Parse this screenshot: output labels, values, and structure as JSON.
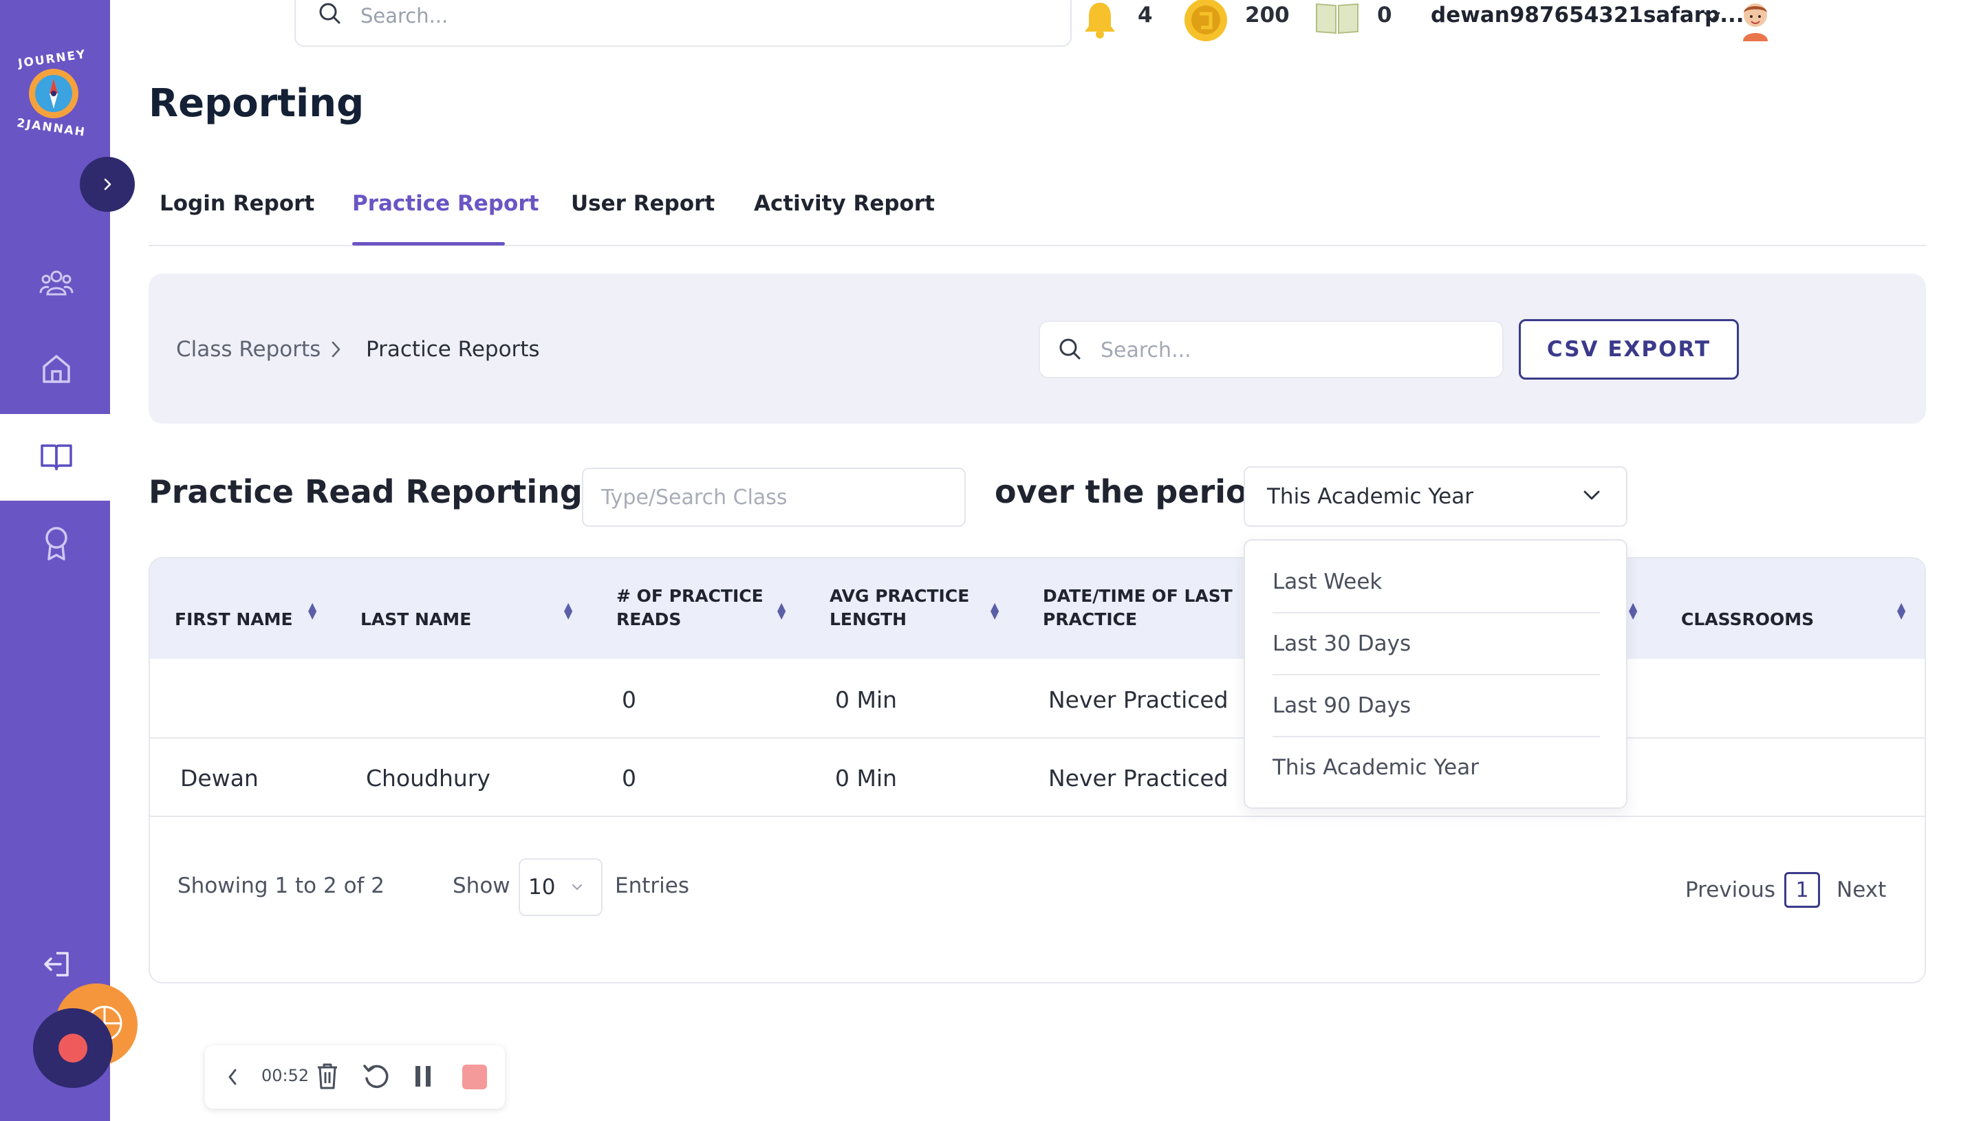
{
  "header": {
    "search_placeholder": "Search...",
    "notifications_count": "4",
    "coins_count": "200",
    "books_count": "0",
    "username": "dewan987654321safarp..."
  },
  "logo": {
    "text_top": "JOURNEY",
    "text_bottom": "2JANNAH"
  },
  "page": {
    "title": "Reporting"
  },
  "tabs": [
    {
      "label": "Login Report"
    },
    {
      "label": "Practice Report",
      "active": true
    },
    {
      "label": "User Report"
    },
    {
      "label": "Activity Report"
    }
  ],
  "breadcrumb": {
    "parent": "Class Reports",
    "current": "Practice Reports"
  },
  "panel": {
    "search_placeholder": "Search...",
    "csv_label": "CSV EXPORT"
  },
  "filters": {
    "label_prefix": "Practice Read Reporting for",
    "class_placeholder": "Type/Search Class",
    "label_period": "over the period",
    "period_value": "This Academic Year",
    "period_options": [
      "Last Week",
      "Last 30 Days",
      "Last 90 Days",
      "This Academic Year"
    ]
  },
  "table": {
    "headers": {
      "first_name": "FIRST NAME",
      "last_name": "LAST NAME",
      "reads_l1": "# OF PRACTICE",
      "reads_l2": "READS",
      "avg_l1": "AVG PRACTICE",
      "avg_l2": "LENGTH",
      "date_l1": "DATE/TIME OF LAST",
      "date_l2": "PRACTICE",
      "classrooms": "CLASSROOMS"
    },
    "rows": [
      {
        "first": "",
        "last": "",
        "reads": "0",
        "avg": "0 Min",
        "last_practice": "Never Practiced",
        "classrooms": ""
      },
      {
        "first": "Dewan",
        "last": "Choudhury",
        "reads": "0",
        "avg": "0 Min",
        "last_practice": "Never Practiced",
        "classrooms": ""
      }
    ]
  },
  "footer": {
    "showing": "Showing 1 to 2 of 2",
    "show_label": "Show",
    "entries_value": "10",
    "entries_label": "Entries",
    "previous": "Previous",
    "page": "1",
    "next": "Next"
  },
  "recorder": {
    "time": "00:52"
  },
  "colors": {
    "sidebar": "#6a55c4",
    "accent": "#6a55c4",
    "dark": "#2f2a6e",
    "record": "#ef5b5b"
  }
}
